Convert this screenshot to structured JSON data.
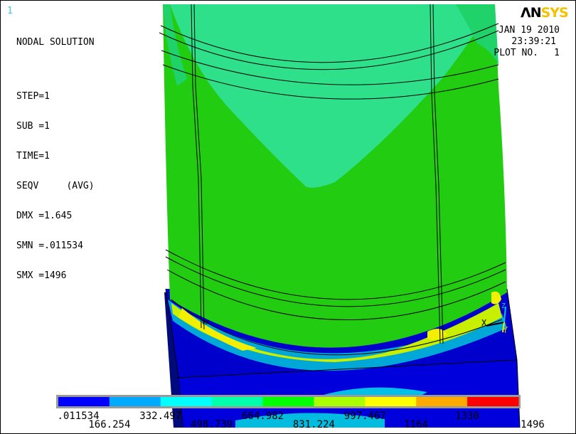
{
  "window": {
    "number": "1"
  },
  "logo": {
    "part1": "ΛN",
    "part2": "SYS"
  },
  "info": {
    "title": "NODAL SOLUTION",
    "step": "STEP=1",
    "sub": "SUB =1",
    "time": "TIME=1",
    "result": "SEQV     (AVG)",
    "dmx": "DMX =1.645",
    "smn": "SMN =.011534",
    "smx": "SMX =1496"
  },
  "stamp": {
    "date": "JAN 19 2010",
    "time": "23:39:21",
    "plot_label": "PLOT NO.",
    "plot_number": "1"
  },
  "markers": {
    "mx": "MX",
    "axis_x": "X",
    "axis_y": "Y",
    "axis_z": "Z"
  },
  "legend": {
    "colors": [
      "#0000ff",
      "#00aaff",
      "#00ffff",
      "#00ffaa",
      "#00ff00",
      "#aaff00",
      "#ffff00",
      "#ffaa00",
      "#ff0000"
    ],
    "labels": [
      ".011534",
      "166.254",
      "332.497",
      "498.739",
      "664.982",
      "831.224",
      "997.467",
      "1164",
      "1330",
      "1496"
    ]
  },
  "palette": {
    "tube_green": "#22cc11",
    "tube_light": "#2ee08a",
    "base_blue": "#0000dd",
    "base_dark": "#000a7a",
    "base_side": "#0a0aa0",
    "yellow_zone": "#d8e800",
    "cyan_zone": "#00a8d8"
  }
}
